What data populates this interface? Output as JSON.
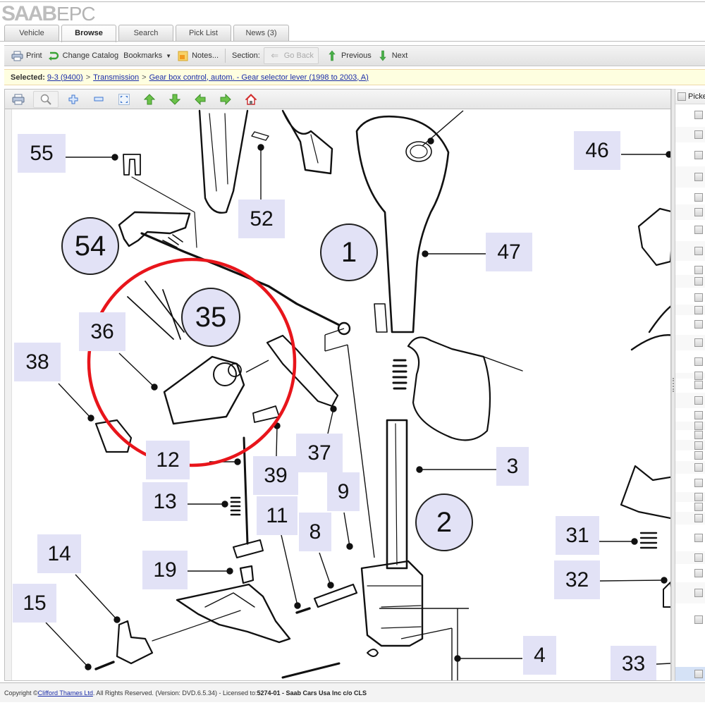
{
  "app": {
    "logo_brand": "SAAB",
    "logo_product": "EPC"
  },
  "tabs": [
    {
      "label": "Vehicle",
      "active": false
    },
    {
      "label": "Browse",
      "active": true
    },
    {
      "label": "Search",
      "active": false
    },
    {
      "label": "Pick List",
      "active": false
    },
    {
      "label": "News (3)",
      "active": false
    }
  ],
  "toolbar": {
    "print": "Print",
    "change_catalog": "Change Catalog",
    "bookmarks": "Bookmarks",
    "notes": "Notes...",
    "section_label": "Section:",
    "go_back": "Go Back",
    "previous": "Previous",
    "next": "Next"
  },
  "breadcrumb": {
    "label": "Selected:",
    "separator": ">",
    "items": [
      "9-3 (9400)",
      "Transmission",
      "Gear box control, autom. - Gear selector lever (1998 to 2003, A)"
    ]
  },
  "diagram_toolbar": {
    "icons": [
      "print-icon",
      "magnifier-icon",
      "zoom-in-icon",
      "zoom-out-icon",
      "fit-to-window-icon",
      "pan-up-icon",
      "pan-down-icon",
      "pan-left-icon",
      "pan-right-icon",
      "home-icon"
    ]
  },
  "diagram": {
    "square_callouts": [
      "55",
      "52",
      "46",
      "47",
      "36",
      "38",
      "37",
      "12",
      "39",
      "9",
      "13",
      "11",
      "8",
      "3",
      "14",
      "19",
      "31",
      "32",
      "15",
      "4",
      "33"
    ],
    "circle_callouts": [
      "54",
      "1",
      "35",
      "2"
    ],
    "highlight_ring_color": "#e8151b",
    "callout_fill": "#e2e2f6"
  },
  "right_pane": {
    "header": "Picked",
    "row_count": 34,
    "selected_row": 34
  },
  "footer": {
    "prefix": "Copyright ©",
    "company_link": "Clifford Thames Ltd",
    "rights": ". All Rights Reserved. (Version: DVD.6.5.34) - Licensed to: ",
    "license": "5274-01 - Saab Cars Usa Inc c/o CLS"
  }
}
